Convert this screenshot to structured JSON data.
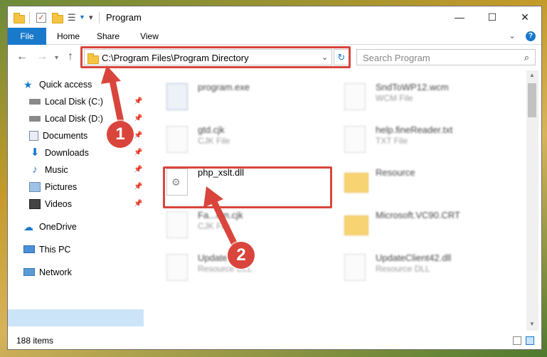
{
  "window": {
    "title": "Program"
  },
  "ribbon": {
    "tabs": [
      "File",
      "Home",
      "Share",
      "View"
    ],
    "help": "?"
  },
  "nav": {
    "address": "C:\\Program Files\\Program Directory",
    "search_placeholder": "Search Program"
  },
  "sidebar": {
    "quick_access": "Quick access",
    "items": [
      {
        "label": "Local Disk (C:)",
        "icon": "drive-icon",
        "pinned": true
      },
      {
        "label": "Local Disk (D:)",
        "icon": "drive-icon",
        "pinned": true
      },
      {
        "label": "Documents",
        "icon": "documents-icon",
        "pinned": true
      },
      {
        "label": "Downloads",
        "icon": "downloads-icon",
        "pinned": true
      },
      {
        "label": "Music",
        "icon": "music-icon",
        "pinned": true
      },
      {
        "label": "Pictures",
        "icon": "pictures-icon",
        "pinned": true
      },
      {
        "label": "Videos",
        "icon": "videos-icon",
        "pinned": true
      }
    ],
    "onedrive": "OneDrive",
    "this_pc": "This PC",
    "network": "Network"
  },
  "files": [
    {
      "name": "program.exe",
      "type": ""
    },
    {
      "name": "SndToWP12.wcm",
      "type": "WCM File"
    },
    {
      "name": "gtd.cjk",
      "type": "CJK File"
    },
    {
      "name": "help.fineReader.txt",
      "type": "TXT File"
    },
    {
      "name": "php_xslt.dll",
      "type": ""
    },
    {
      "name": "Resource",
      "type": ""
    },
    {
      "name": "Fa...om.cjk",
      "type": "CJK File"
    },
    {
      "name": "Microsoft.VC90.CRT",
      "type": ""
    },
    {
      "name": "Update...5.dll",
      "type": "Resource DLL"
    },
    {
      "name": "UpdateClient42.dll",
      "type": "Resource DLL"
    }
  ],
  "status": {
    "count": "188 items"
  },
  "annotations": {
    "step1": "1",
    "step2": "2"
  },
  "colors": {
    "accent": "#1979ca",
    "highlight": "#d9453c",
    "selected": "#cce4f7"
  }
}
